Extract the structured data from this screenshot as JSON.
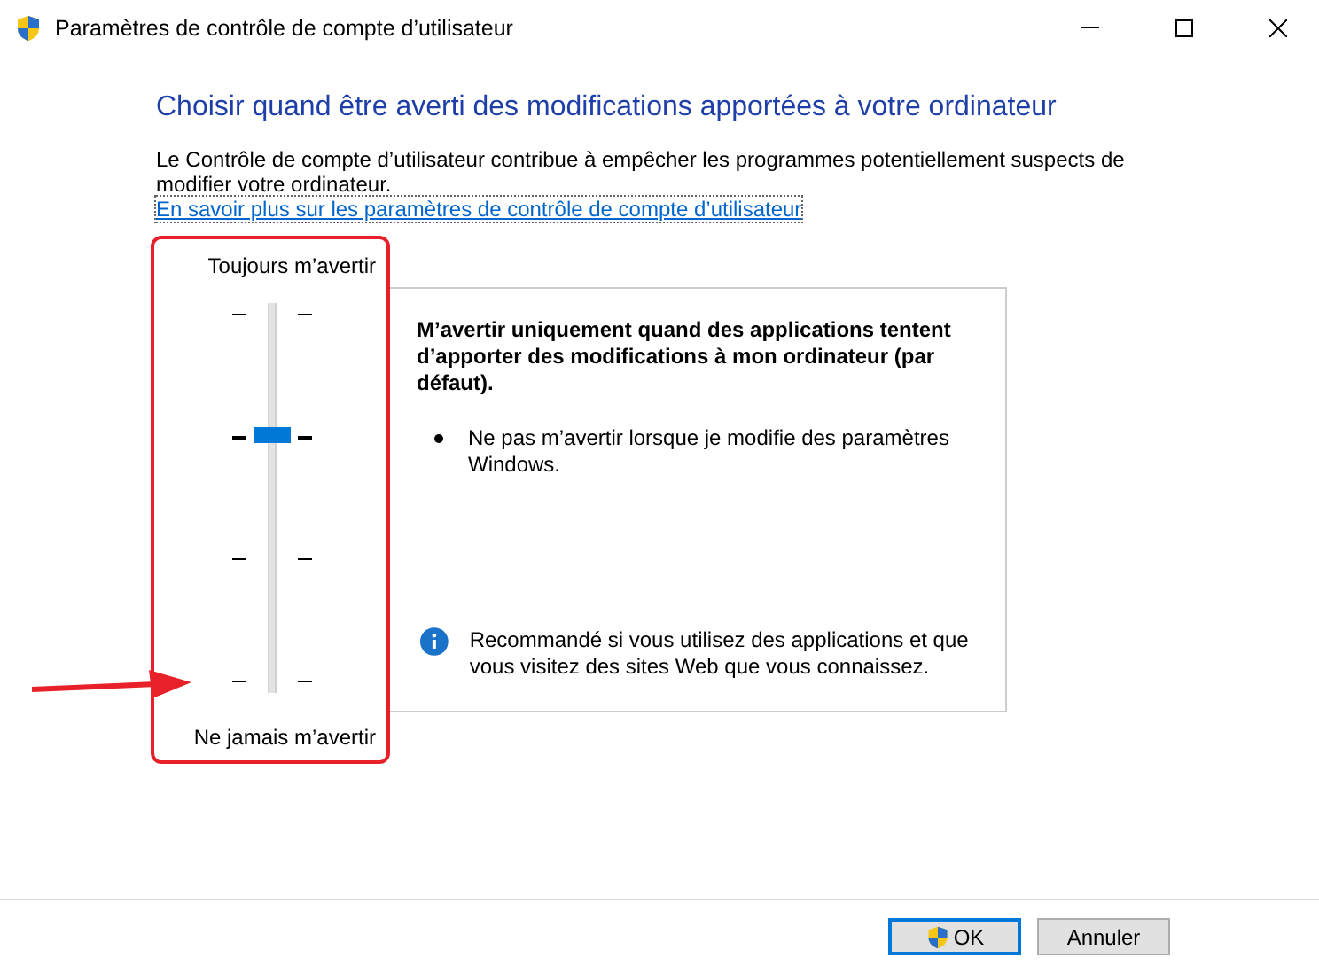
{
  "window": {
    "title": "Paramètres de contrôle de compte d’utilisateur"
  },
  "heading": "Choisir quand être averti des modifications apportées à votre ordinateur",
  "intro": "Le Contrôle de compte d’utilisateur contribue à empêcher les programmes potentiellement suspects de modifier votre ordinateur.",
  "link": "En savoir plus sur les paramètres de contrôle de compte d’utilisateur",
  "slider": {
    "top_label": "Toujours m’avertir",
    "bottom_label": "Ne jamais m’avertir",
    "level": 0.6667
  },
  "description": {
    "title": "M’avertir uniquement quand des applications tentent d’apporter des modifications à mon ordinateur (par défaut).",
    "bullets": [
      "Ne pas m’avertir lorsque je modifie des paramètres Windows."
    ],
    "note": "Recommandé si vous utilisez des applications et que vous visitez des sites Web que vous connaissez."
  },
  "buttons": [
    {
      "label": "OK",
      "default": true,
      "shield": true
    },
    {
      "label": "Annuler",
      "default": false,
      "shield": false
    }
  ]
}
